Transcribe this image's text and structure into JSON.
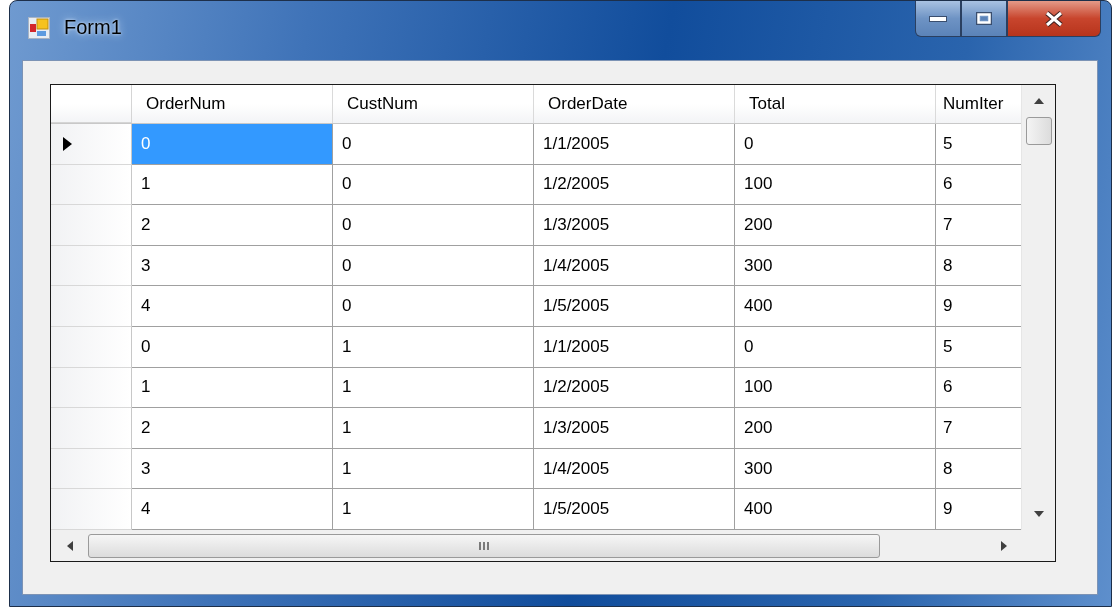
{
  "window": {
    "title": "Form1"
  },
  "grid": {
    "columns": [
      "OrderNum",
      "CustNum",
      "OrderDate",
      "Total",
      "NumIter"
    ],
    "rows": [
      {
        "current": true,
        "cells": [
          {
            "text": "0",
            "selected": true
          },
          {
            "text": "0",
            "selected": false
          },
          {
            "text": "1/1/2005",
            "selected": false
          },
          {
            "text": "0",
            "selected": false
          },
          {
            "text": "5",
            "selected": false
          }
        ]
      },
      {
        "current": false,
        "cells": [
          {
            "text": "1",
            "selected": false
          },
          {
            "text": "0",
            "selected": false
          },
          {
            "text": "1/2/2005",
            "selected": false
          },
          {
            "text": "100",
            "selected": false
          },
          {
            "text": "6",
            "selected": false
          }
        ]
      },
      {
        "current": false,
        "cells": [
          {
            "text": "2",
            "selected": false
          },
          {
            "text": "0",
            "selected": false
          },
          {
            "text": "1/3/2005",
            "selected": false
          },
          {
            "text": "200",
            "selected": false
          },
          {
            "text": "7",
            "selected": false
          }
        ]
      },
      {
        "current": false,
        "cells": [
          {
            "text": "3",
            "selected": false
          },
          {
            "text": "0",
            "selected": false
          },
          {
            "text": "1/4/2005",
            "selected": false
          },
          {
            "text": "300",
            "selected": false
          },
          {
            "text": "8",
            "selected": false
          }
        ]
      },
      {
        "current": false,
        "cells": [
          {
            "text": "4",
            "selected": false
          },
          {
            "text": "0",
            "selected": false
          },
          {
            "text": "1/5/2005",
            "selected": false
          },
          {
            "text": "400",
            "selected": false
          },
          {
            "text": "9",
            "selected": false
          }
        ]
      },
      {
        "current": false,
        "cells": [
          {
            "text": "0",
            "selected": false
          },
          {
            "text": "1",
            "selected": false
          },
          {
            "text": "1/1/2005",
            "selected": false
          },
          {
            "text": "0",
            "selected": false
          },
          {
            "text": "5",
            "selected": false
          }
        ]
      },
      {
        "current": false,
        "cells": [
          {
            "text": "1",
            "selected": false
          },
          {
            "text": "1",
            "selected": false
          },
          {
            "text": "1/2/2005",
            "selected": false
          },
          {
            "text": "100",
            "selected": false
          },
          {
            "text": "6",
            "selected": false
          }
        ]
      },
      {
        "current": false,
        "cells": [
          {
            "text": "2",
            "selected": false
          },
          {
            "text": "1",
            "selected": false
          },
          {
            "text": "1/3/2005",
            "selected": false
          },
          {
            "text": "200",
            "selected": false
          },
          {
            "text": "7",
            "selected": false
          }
        ]
      },
      {
        "current": false,
        "cells": [
          {
            "text": "3",
            "selected": false
          },
          {
            "text": "1",
            "selected": false
          },
          {
            "text": "1/4/2005",
            "selected": false
          },
          {
            "text": "300",
            "selected": false
          },
          {
            "text": "8",
            "selected": false
          }
        ]
      },
      {
        "current": false,
        "cells": [
          {
            "text": "4",
            "selected": false
          },
          {
            "text": "1",
            "selected": false
          },
          {
            "text": "1/5/2005",
            "selected": false
          },
          {
            "text": "400",
            "selected": false
          },
          {
            "text": "9",
            "selected": false
          }
        ]
      }
    ]
  }
}
